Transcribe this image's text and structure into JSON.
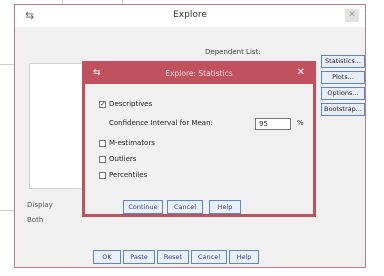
{
  "window": {
    "title": "Explore",
    "close_label": "✕",
    "dependent_list_label": "Dependent List:",
    "side_buttons": [
      "Statistics...",
      "Plots...",
      "Options...",
      "Bootstrap..."
    ],
    "display_label": "Display",
    "both_label": "Both",
    "bottom_buttons": [
      "OK",
      "Paste",
      "Reset",
      "Cancel",
      "Help"
    ]
  },
  "dialog": {
    "title": "Explore: Statistics",
    "close_label": "✕",
    "descriptives": {
      "label": "Descriptives",
      "checked": true
    },
    "confidence": {
      "label": "Confidence Interval for Mean:",
      "value": "95",
      "unit": "%"
    },
    "m_estimators": {
      "label": "M-estimators",
      "checked": false
    },
    "outliers": {
      "label": "Outliers",
      "checked": false
    },
    "percentiles": {
      "label": "Percentiles",
      "checked": false
    },
    "buttons": [
      "Continue",
      "Cancel",
      "Help"
    ]
  },
  "colors": {
    "dialog_accent": "#c2515f",
    "button_border": "#5b86c9"
  }
}
